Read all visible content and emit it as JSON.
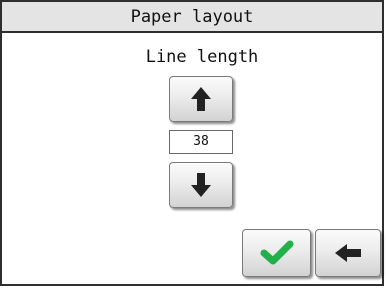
{
  "window": {
    "title": "Paper layout"
  },
  "setting": {
    "label": "Line length",
    "value": "38"
  },
  "buttons": {
    "increase_icon": "arrow-up-icon",
    "decrease_icon": "arrow-down-icon",
    "confirm_icon": "checkmark-icon",
    "back_icon": "arrow-left-icon"
  },
  "colors": {
    "confirm": "#21b04a",
    "arrows": "#222222"
  }
}
